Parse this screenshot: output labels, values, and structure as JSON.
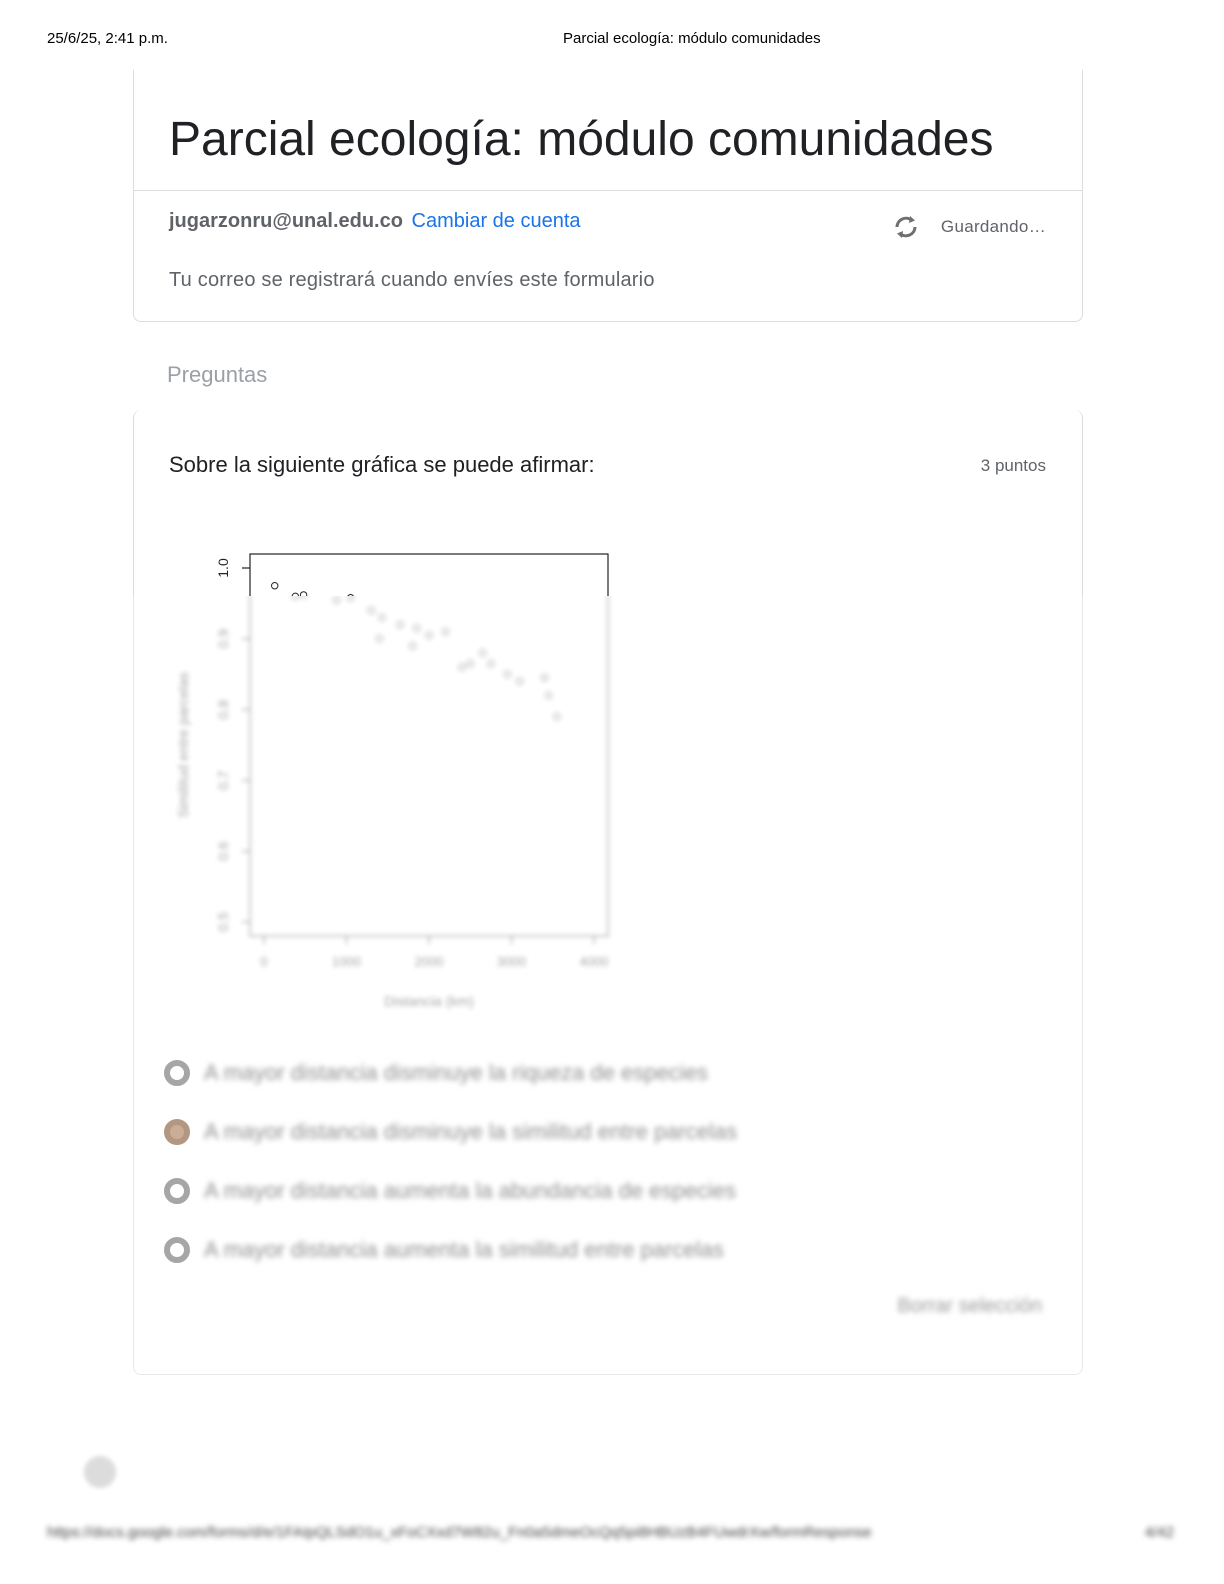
{
  "print_header": {
    "datetime": "25/6/25, 2:41 p.m.",
    "title": "Parcial ecología: módulo comunidades"
  },
  "form": {
    "title": "Parcial ecología: módulo comunidades",
    "account_email": "jugarzonru@unal.edu.co",
    "switch_account": "Cambiar de cuenta",
    "saving_status": "Guardando…",
    "note": "Tu correo se registrará cuando envíes este formulario",
    "icons": {
      "saving": "sync-icon"
    }
  },
  "section_label": "Preguntas",
  "question": {
    "title": "Sobre la siguiente gráfica se puede afirmar:",
    "points": "3 puntos",
    "options": [
      {
        "label": "A mayor distancia disminuye la riqueza de especies",
        "selected": false
      },
      {
        "label": "A mayor distancia disminuye la similitud entre parcelas",
        "selected": true
      },
      {
        "label": "A mayor distancia aumenta la abundancia de especies",
        "selected": false
      },
      {
        "label": "A mayor distancia aumenta la similitud entre parcelas",
        "selected": false
      }
    ],
    "clear_selection": "Borrar selección"
  },
  "chart_data": {
    "type": "scatter",
    "title": "",
    "xlabel": "Distancia (km)",
    "ylabel": "Similitud entre parcelas",
    "xlim": [
      0,
      4000
    ],
    "ylim": [
      0.5,
      1.0
    ],
    "x_ticks": [
      "0",
      "1000",
      "2000",
      "3000",
      "4000"
    ],
    "y_ticks": [
      "0.5",
      "0.6",
      "0.7",
      "0.8",
      "0.9",
      "1.0"
    ],
    "points": [
      {
        "x": 130,
        "y": 0.975
      },
      {
        "x": 380,
        "y": 0.96
      },
      {
        "x": 480,
        "y": 0.962
      },
      {
        "x": 880,
        "y": 0.955
      },
      {
        "x": 1050,
        "y": 0.958
      },
      {
        "x": 1300,
        "y": 0.94
      },
      {
        "x": 1430,
        "y": 0.93
      },
      {
        "x": 1650,
        "y": 0.92
      },
      {
        "x": 1850,
        "y": 0.915
      },
      {
        "x": 2000,
        "y": 0.905
      },
      {
        "x": 2200,
        "y": 0.91
      },
      {
        "x": 1400,
        "y": 0.9
      },
      {
        "x": 1800,
        "y": 0.89
      },
      {
        "x": 2400,
        "y": 0.86
      },
      {
        "x": 2500,
        "y": 0.865
      },
      {
        "x": 2650,
        "y": 0.88
      },
      {
        "x": 2750,
        "y": 0.865
      },
      {
        "x": 2950,
        "y": 0.85
      },
      {
        "x": 3100,
        "y": 0.84
      },
      {
        "x": 3400,
        "y": 0.845
      },
      {
        "x": 3450,
        "y": 0.82
      },
      {
        "x": 3550,
        "y": 0.79
      }
    ]
  },
  "footer": {
    "url": "https://docs.google.com/forms/d/e/1FAIpQLSdO1u_xFoCXxd7W82u_Fn0a5dmeOcQq5pi8HBUzB4FUwdrXw/formResponse",
    "page": "4/42"
  }
}
